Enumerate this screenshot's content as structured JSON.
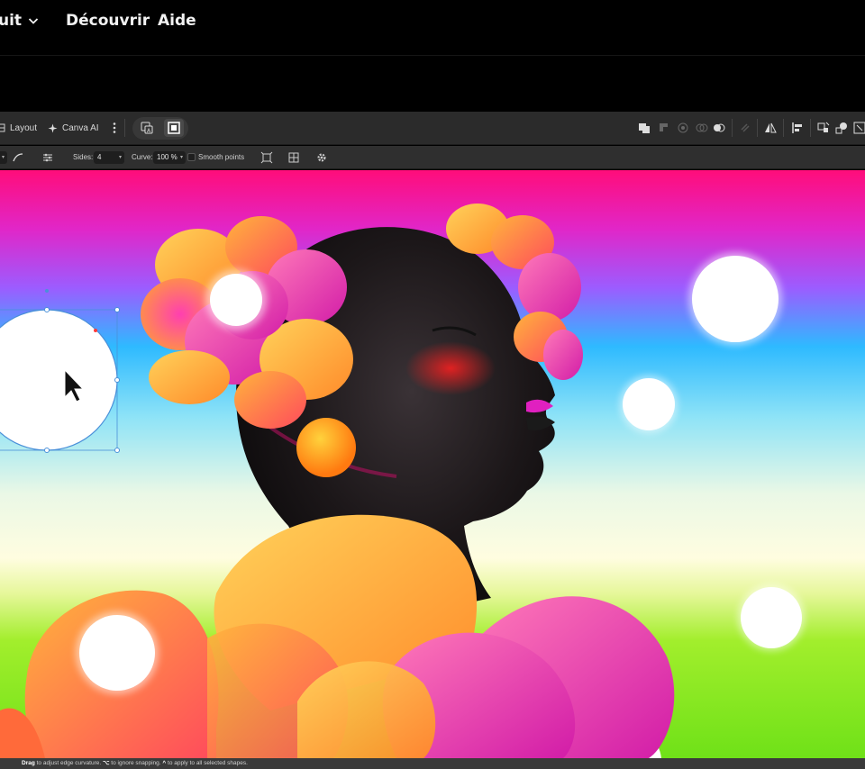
{
  "nav": {
    "product_label": "uit",
    "discover_label": "Découvrir",
    "help_label": "Aide"
  },
  "toolbar": {
    "layout_label": "Layout",
    "canva_ai_label": "Canva AI"
  },
  "context_toolbar": {
    "sides_label": "Sides:",
    "sides_value": "4",
    "curve_label": "Curve:",
    "curve_value": "100 %",
    "smooth_points_label": "Smooth points"
  },
  "status_bar": {
    "drag_label": "Drag",
    "drag_text": "to adjust edge curvature.",
    "snap_key": "⌥",
    "snap_text": "to ignore snapping.",
    "all_key": "^",
    "all_text": "to apply to all selected shapes."
  },
  "colors": {
    "app_bg": "#2b2b2b",
    "selection": "#4a90d9",
    "canvas_top": "#ff0f7b",
    "canvas_mid": "#2fb7ff",
    "canvas_bottom": "#7ee81c"
  }
}
